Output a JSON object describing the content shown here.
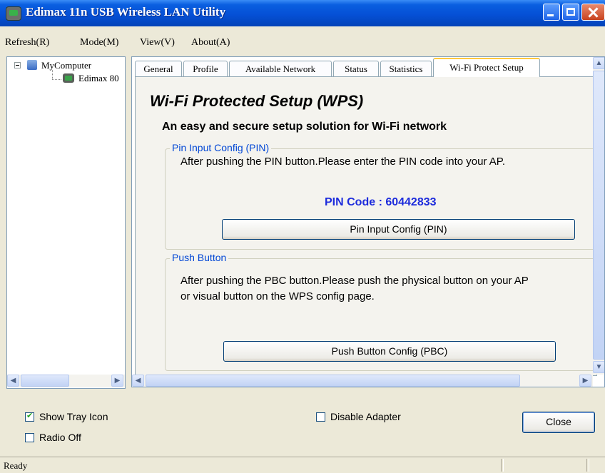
{
  "window": {
    "title": "Edimax 11n USB Wireless LAN Utility"
  },
  "menu": [
    "Refresh(R)",
    "Mode(M)",
    "View(V)",
    "About(A)"
  ],
  "tree": {
    "root": "MyComputer",
    "child": "Edimax 80"
  },
  "tabs": [
    "General",
    "Profile",
    "Available Network",
    "Status",
    "Statistics",
    "Wi-Fi Protect Setup"
  ],
  "active_tab": "Wi-Fi Protect Setup",
  "wps": {
    "title": "Wi-Fi Protected Setup (WPS)",
    "subtitle": "An easy and secure setup solution for Wi-Fi network",
    "pin_group": {
      "legend": "Pin Input Config (PIN)",
      "description": "After pushing the PIN button.Please enter the PIN code into your AP.",
      "pin_code": "PIN Code :  60442833",
      "button": "Pin Input Config (PIN)"
    },
    "pbc_group": {
      "legend": "Push Button",
      "description_line1": "After pushing the PBC button.Please push the physical button on your AP",
      "description_line2": "or visual button on the WPS config page.",
      "button": "Push Button Config (PBC)"
    }
  },
  "bottom": {
    "show_tray_icon": {
      "label": "Show Tray Icon",
      "checked": true
    },
    "radio_off": {
      "label": "Radio Off",
      "checked": false
    },
    "disable_adapter": {
      "label": "Disable Adapter",
      "checked": false
    },
    "close_button": "Close"
  },
  "statusbar": {
    "text": "Ready"
  },
  "scroll": {
    "arrow_left": "◀",
    "arrow_right": "▶",
    "arrow_up": "▲",
    "arrow_down": "▼"
  }
}
